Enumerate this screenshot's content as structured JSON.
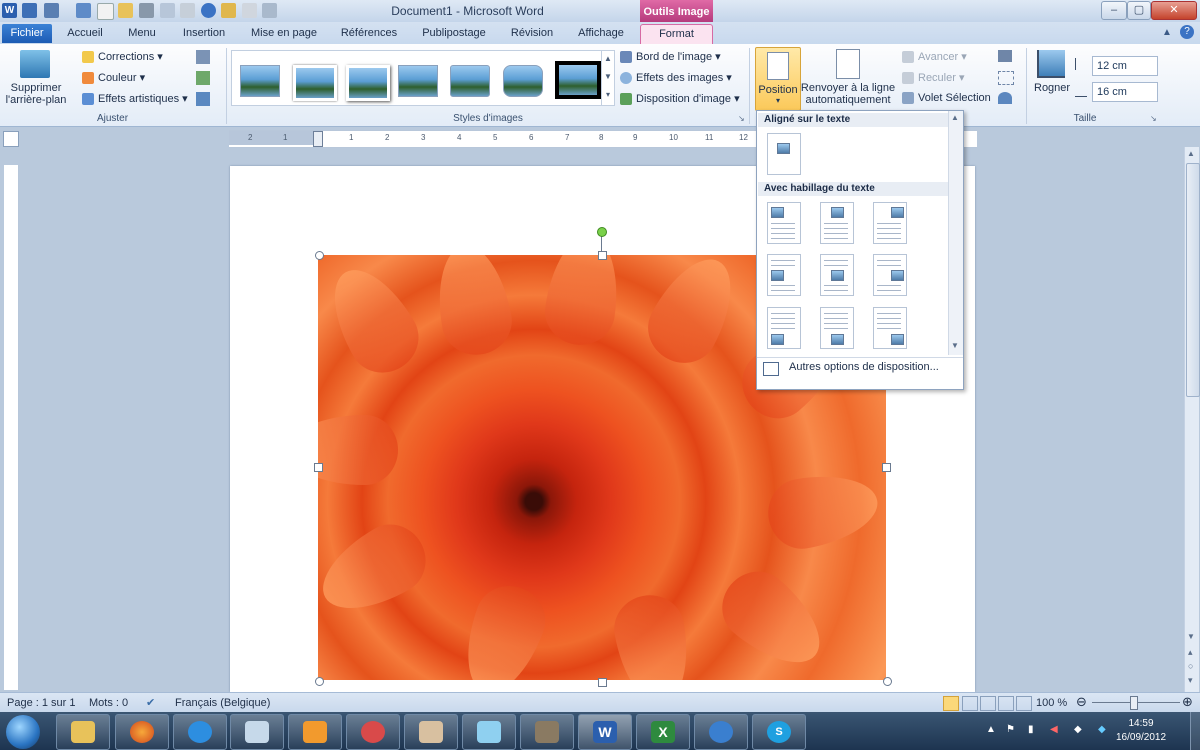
{
  "window": {
    "title": "Document1 - Microsoft Word",
    "context_tab_header": "Outils Image"
  },
  "tabs": [
    "Fichier",
    "Accueil",
    "Menu",
    "Insertion",
    "Mise en page",
    "Références",
    "Publipostage",
    "Révision",
    "Affichage",
    "Format"
  ],
  "ribbon": {
    "adjust": {
      "remove_bg": "Supprimer l'arrière-plan",
      "corrections": "Corrections",
      "color": "Couleur",
      "artistic": "Effets artistiques",
      "label": "Ajuster"
    },
    "styles": {
      "label": "Styles d'images",
      "border": "Bord de l'image",
      "effects": "Effets des images",
      "layout": "Disposition d'image"
    },
    "arrange": {
      "position": "Position",
      "wrap": "Renvoyer à la ligne automatiquement",
      "forward": "Avancer",
      "backward": "Reculer",
      "selection_pane": "Volet Sélection"
    },
    "size": {
      "crop": "Rogner",
      "height": "12 cm",
      "width": "16 cm",
      "label": "Taille"
    }
  },
  "ruler": {
    "labels": [
      "2",
      "1",
      "1",
      "2",
      "3",
      "4",
      "5",
      "6",
      "7",
      "8",
      "9",
      "10",
      "11",
      "12"
    ]
  },
  "position_menu": {
    "section_inline": "Aligné sur le texte",
    "section_wrap": "Avec habillage du texte",
    "more_options": "Autres options de disposition..."
  },
  "status": {
    "page": "Page : 1 sur 1",
    "words": "Mots : 0",
    "language": "Français (Belgique)",
    "zoom": "100 %"
  },
  "taskbar": {
    "time": "14:59",
    "date": "16/09/2012"
  },
  "colors": {
    "accent_tab": "#d66aa4",
    "file_tab": "#1c5bb4",
    "flower": "#ee5220"
  }
}
